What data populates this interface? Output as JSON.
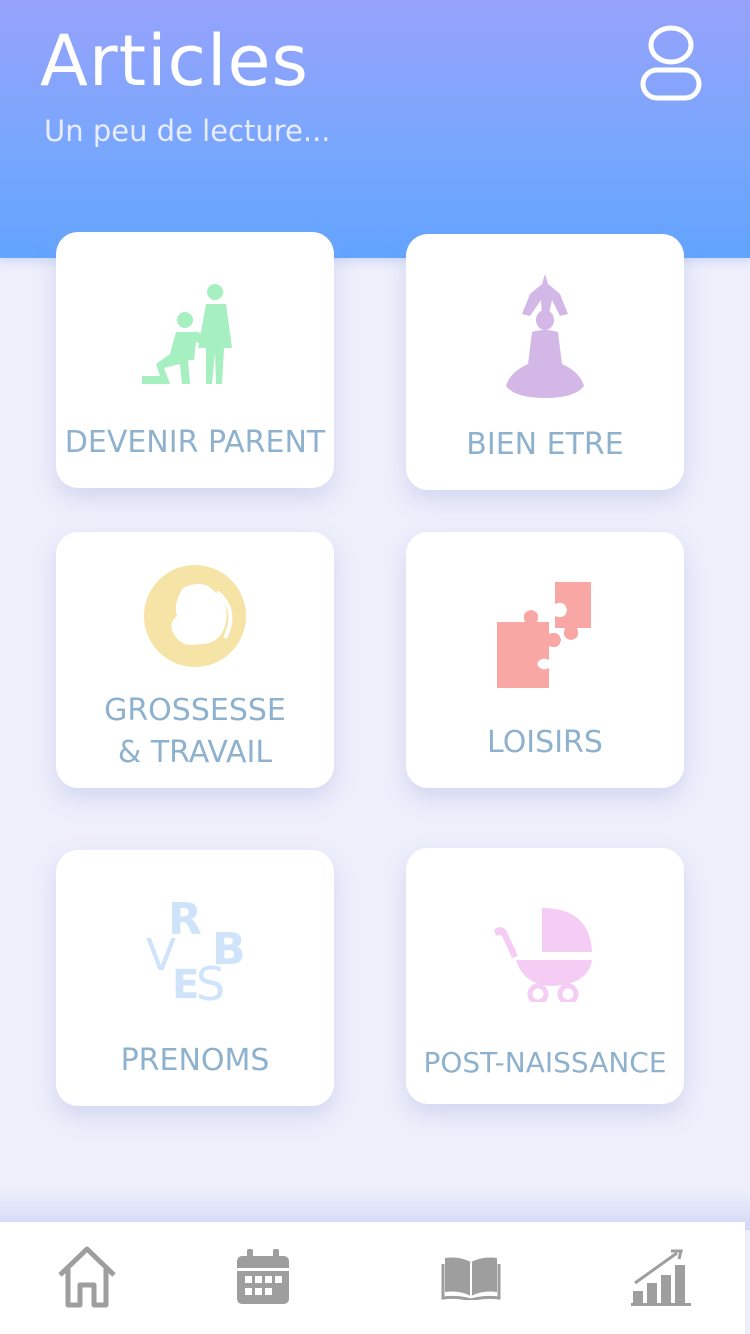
{
  "header": {
    "title": "Articles",
    "subtitle": "Un peu de lecture..."
  },
  "categories": [
    {
      "label": "DEVENIR PARENT",
      "icon": "expecting-parents-icon",
      "color": "#a5efc0"
    },
    {
      "label": "BIEN ETRE",
      "icon": "yoga-icon",
      "color": "#d3b8e7"
    },
    {
      "label_line1": "GROSSESSE",
      "label_line2": "& TRAVAIL",
      "icon": "fetus-icon",
      "color": "#f6e3a6"
    },
    {
      "label": "LOISIRS",
      "icon": "puzzle-icon",
      "color": "#f8a7a4"
    },
    {
      "label": "PRENOMS",
      "icon": "letters-icon",
      "color": "#d6e9fb",
      "icon_letters": [
        "R",
        "B",
        "V",
        "E",
        "S"
      ]
    },
    {
      "label": "POST-NAISSANCE",
      "icon": "stroller-icon",
      "color": "#f5cdf4"
    }
  ],
  "tabbar": {
    "items": [
      {
        "icon": "home-icon"
      },
      {
        "icon": "calendar-icon"
      },
      {
        "icon": "book-icon"
      },
      {
        "icon": "stats-icon"
      }
    ],
    "icon_color": "#9e9e9e"
  }
}
